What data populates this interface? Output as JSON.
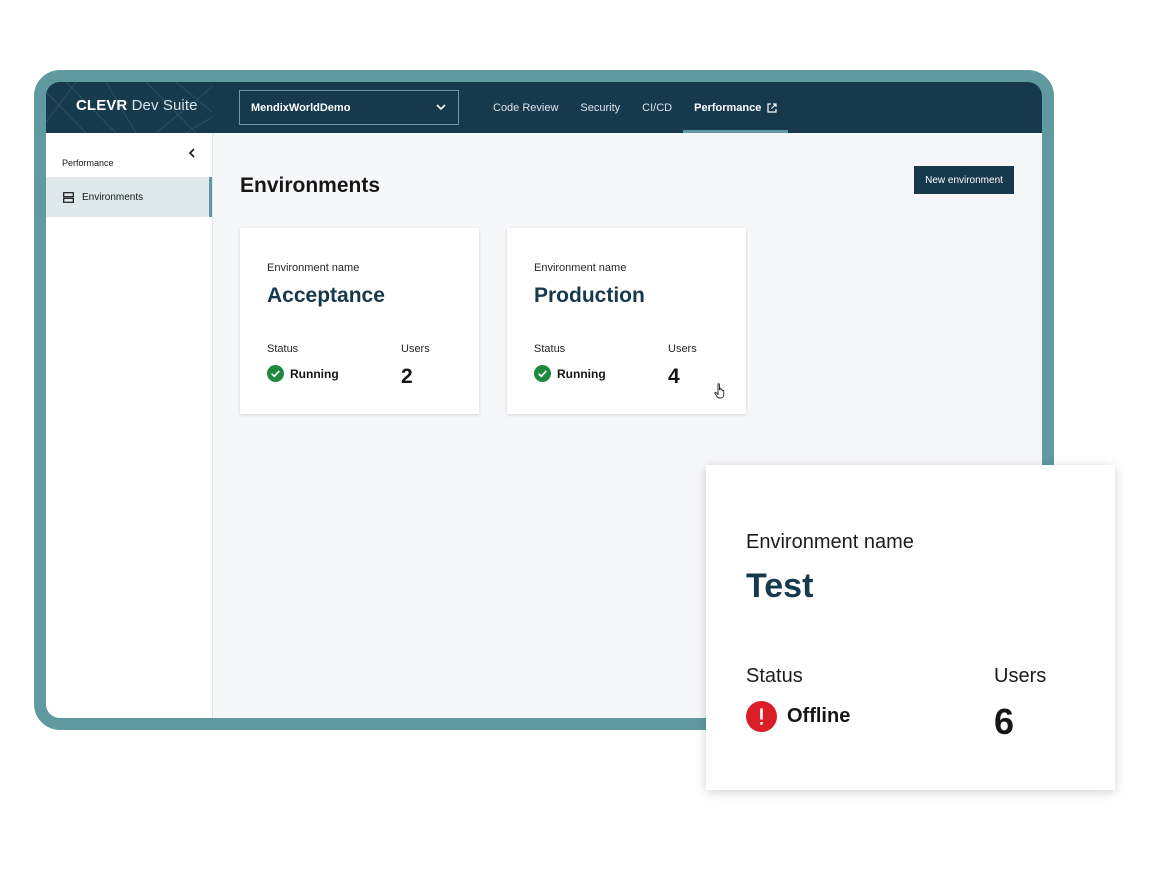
{
  "brand": {
    "name": "CLEVR",
    "suffix": " Dev Suite"
  },
  "app_selector": {
    "value": "MendixWorldDemo"
  },
  "nav": {
    "items": [
      {
        "label": "Code Review"
      },
      {
        "label": "Security"
      },
      {
        "label": "CI/CD"
      },
      {
        "label": "Performance",
        "active": true
      }
    ]
  },
  "sidebar": {
    "section_title": "Performance",
    "items": [
      {
        "label": "Environments",
        "icon": "server-icon"
      }
    ]
  },
  "main": {
    "title": "Environments",
    "new_button": "New environment",
    "cards": [
      {
        "label": "Environment name",
        "name": "Acceptance",
        "status_label": "Status",
        "status": "Running",
        "users_label": "Users",
        "users": "2"
      },
      {
        "label": "Environment name",
        "name": "Production",
        "status_label": "Status",
        "status": "Running",
        "users_label": "Users",
        "users": "4"
      }
    ]
  },
  "zoom_card": {
    "label": "Environment name",
    "name": "Test",
    "status_label": "Status",
    "status": "Offline",
    "users_label": "Users",
    "users": "6"
  },
  "colors": {
    "frame": "#5e9aa0",
    "header": "#17394d",
    "running": "#24a148",
    "offline": "#da1e28"
  }
}
